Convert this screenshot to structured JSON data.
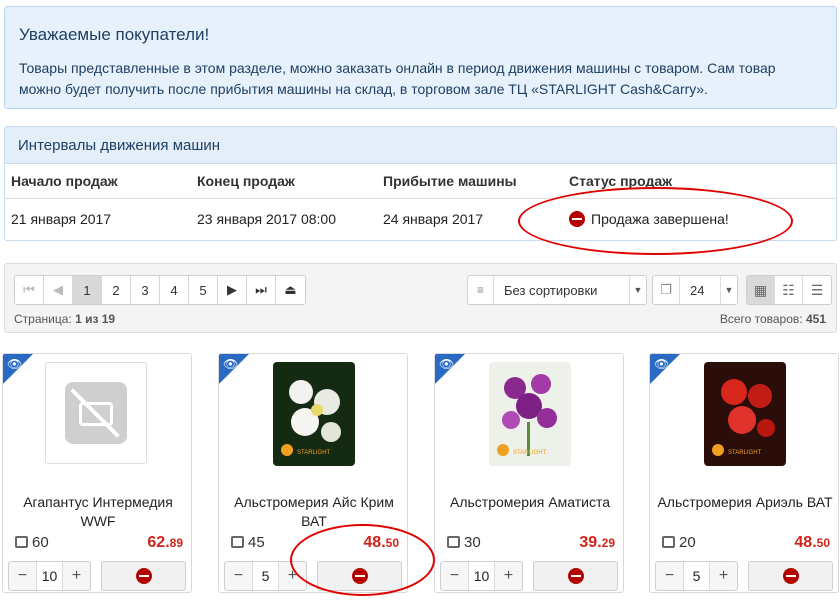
{
  "notice": {
    "title": "Уважаемые покупатели!",
    "text": "Товары представленные в этом разделе, можно заказать онлайн в период движения машины с товаром. Сам товар можно будет получить после прибытия машины на склад, в торговом зале ТЦ «STARLIGHT Cash&Carry»."
  },
  "intervals": {
    "title": "Интервалы движения машин",
    "headers": [
      "Начало продаж",
      "Конец продаж",
      "Прибытие машины",
      "Статус продаж"
    ],
    "row": {
      "start": "21 января 2017",
      "end": "23 января 2017 08:00",
      "arrival": "24 января 2017",
      "status": "Продажа завершена!"
    }
  },
  "toolbar": {
    "pages": [
      "1",
      "2",
      "3",
      "4",
      "5"
    ],
    "active_page": "1",
    "page_info_label": "Страница:",
    "page_info_value": "1 из 19",
    "sort_value": "Без сортировки",
    "per_page": "24",
    "total_label": "Всего товаров:",
    "total_value": "451"
  },
  "colors": {
    "accent": "#2a6ac3",
    "price": "#d0241b",
    "stop": "#b30000",
    "highlight_ring": "#e00000"
  },
  "products": [
    {
      "name": "Агапантус Интермедия WWF",
      "stock": "60",
      "price_int": "62.",
      "price_dec": "89",
      "qty": "10",
      "image": "no-photo"
    },
    {
      "name": "Альстромерия Айс Крим ВАТ",
      "stock": "45",
      "price_int": "48.",
      "price_dec": "50",
      "qty": "5",
      "image": "white-flower"
    },
    {
      "name": "Альстромерия Аматиста",
      "stock": "30",
      "price_int": "39.",
      "price_dec": "29",
      "qty": "10",
      "image": "purple-flower"
    },
    {
      "name": "Альстромерия Ариэль ВАТ",
      "stock": "20",
      "price_int": "48.",
      "price_dec": "50",
      "qty": "5",
      "image": "red-flower"
    }
  ]
}
